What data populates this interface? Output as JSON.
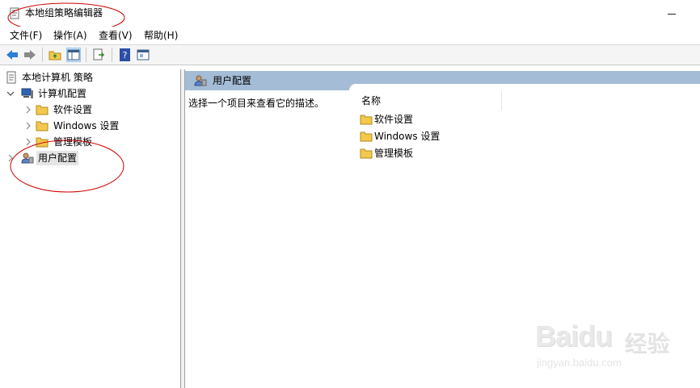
{
  "window": {
    "title": "本地组策略编辑器"
  },
  "menu": {
    "items": [
      {
        "label": "文件(F)"
      },
      {
        "label": "操作(A)"
      },
      {
        "label": "查看(V)"
      },
      {
        "label": "帮助(H)"
      }
    ]
  },
  "toolbar": {
    "buttons": [
      "back-arrow-icon",
      "forward-arrow-icon",
      "up-folder-icon",
      "show-hide-tree-icon",
      "export-list-icon",
      "help-icon",
      "properties-icon"
    ]
  },
  "tree": {
    "root": {
      "label": "本地计算机 策略"
    },
    "computer_config": {
      "label": "计算机配置"
    },
    "software_settings": {
      "label": "软件设置"
    },
    "windows_settings": {
      "label": "Windows 设置"
    },
    "admin_templates": {
      "label": "管理模板"
    },
    "user_config": {
      "label": "用户配置"
    }
  },
  "right": {
    "header_title": "用户配置",
    "description": "选择一个项目来查看它的描述。",
    "column_name": "名称",
    "items": [
      {
        "label": "软件设置"
      },
      {
        "label": "Windows 设置"
      },
      {
        "label": "管理模板"
      }
    ]
  },
  "watermark": {
    "brand": "Baidu",
    "cn": "经验",
    "url": "jingyan.baidu.com"
  },
  "colors": {
    "header_bg": "#a4bcd6",
    "annotation_red": "#cc0000",
    "folder_yellow": "#f3c84c"
  }
}
